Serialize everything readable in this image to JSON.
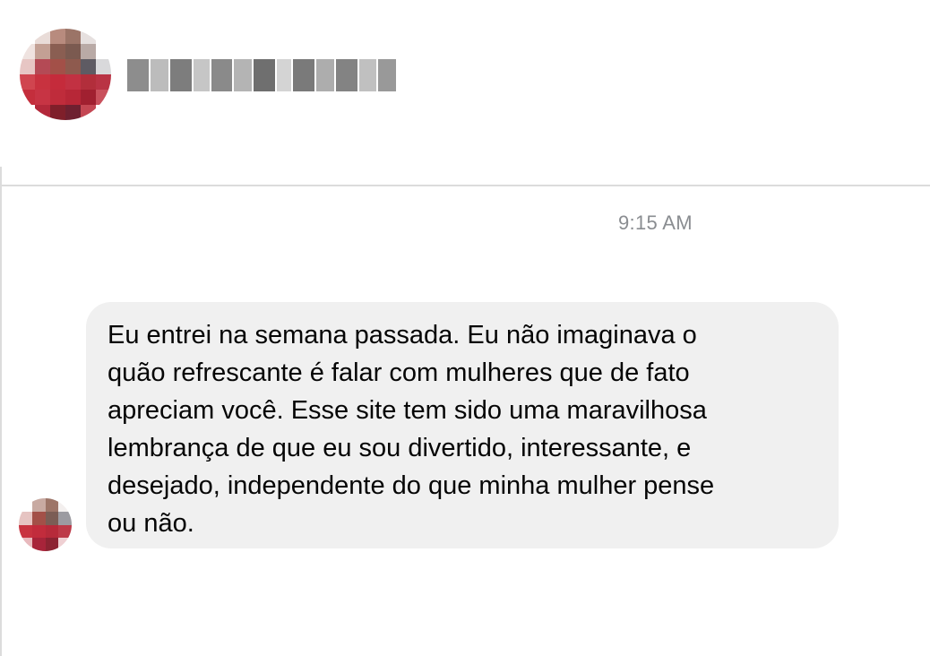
{
  "contact": {
    "name_blurred": true
  },
  "conversation": {
    "timestamp": "9:15 AM",
    "messages": [
      {
        "text": "Eu entrei na semana passada. Eu não imaginava o\nquão refrescante é falar com mulheres que de fato\napreciam você. Esse site tem sido uma maravilhosa\nlembrança de que eu sou divertido, interessante, e\ndesejado, independente do que minha mulher pense\nou não."
      }
    ]
  },
  "colors": {
    "bubble": "#f0f0f0",
    "timestamp": "#8a8d91",
    "text": "#050505",
    "divider": "#dcdcdc"
  }
}
